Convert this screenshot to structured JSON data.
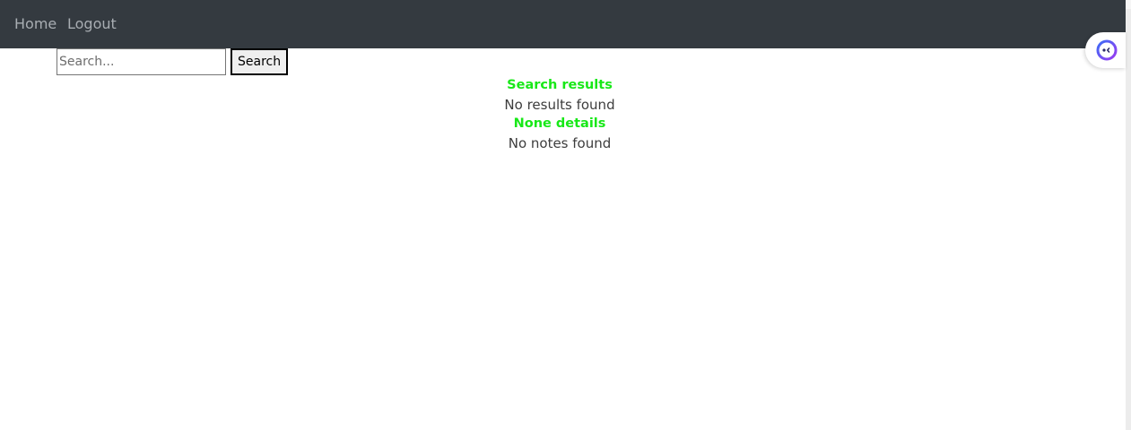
{
  "navbar": {
    "home_label": "Home",
    "logout_label": "Logout",
    "background": "#343a40"
  },
  "search": {
    "placeholder": "Search...",
    "value": "",
    "button_label": "Search"
  },
  "results": {
    "search_heading": "Search results",
    "search_message": "No results found",
    "details_heading": "None details",
    "notes_message": "No notes found",
    "heading_color": "#18e818"
  },
  "assistant": {
    "icon": "assistant-face-icon"
  }
}
